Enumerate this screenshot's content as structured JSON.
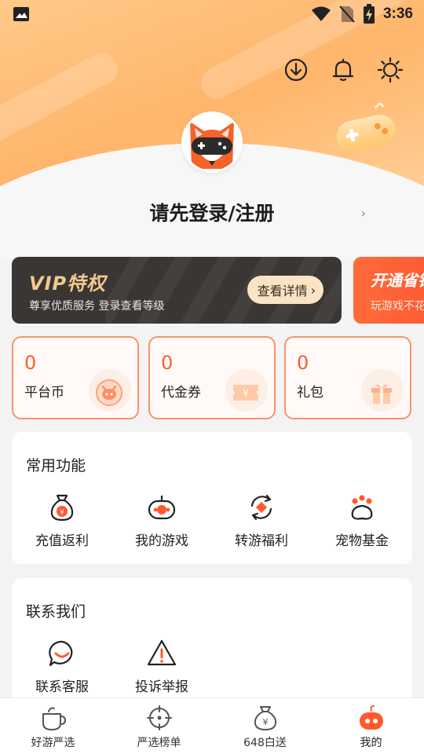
{
  "status_bar": {
    "time": "3:36"
  },
  "profile": {
    "login_prompt": "请先登录/注册",
    "chevron": "›"
  },
  "banners": [
    {
      "title": "VIP特权",
      "subtitle": "尊享优质服务  登录查看等级",
      "button_label": "查看详情",
      "button_chevron": "›"
    },
    {
      "title": "开通省钱",
      "subtitle": "玩游戏不花"
    }
  ],
  "wallet": [
    {
      "value": "0",
      "label": "平台币",
      "icon": "piggy-coin-icon"
    },
    {
      "value": "0",
      "label": "代金券",
      "icon": "voucher-icon"
    },
    {
      "value": "0",
      "label": "礼包",
      "icon": "gift-box-icon"
    }
  ],
  "common_functions": {
    "title": "常用功能",
    "items": [
      {
        "label": "充值返利",
        "icon": "money-bag-icon"
      },
      {
        "label": "我的游戏",
        "icon": "gamepad-icon"
      },
      {
        "label": "转游福利",
        "icon": "transfer-icon"
      },
      {
        "label": "宠物基金",
        "icon": "paw-icon"
      }
    ]
  },
  "contact": {
    "title": "联系我们",
    "items": [
      {
        "label": "联系客服",
        "icon": "chat-bubble-icon"
      },
      {
        "label": "投诉举报",
        "icon": "warning-triangle-icon"
      }
    ]
  },
  "bottom_nav": [
    {
      "label": "好游严选",
      "icon": "cup-icon",
      "active": false
    },
    {
      "label": "严选榜单",
      "icon": "target-icon",
      "active": false
    },
    {
      "label": "648白送",
      "icon": "coin-bag-icon",
      "active": false
    },
    {
      "label": "我的",
      "icon": "robot-mascot-icon",
      "active": true
    }
  ],
  "colors": {
    "accent": "#ff5a2c",
    "header_orange": "#ffb56b",
    "vip_gold": "#f2c98f",
    "vip_dark": "#3a3633"
  }
}
